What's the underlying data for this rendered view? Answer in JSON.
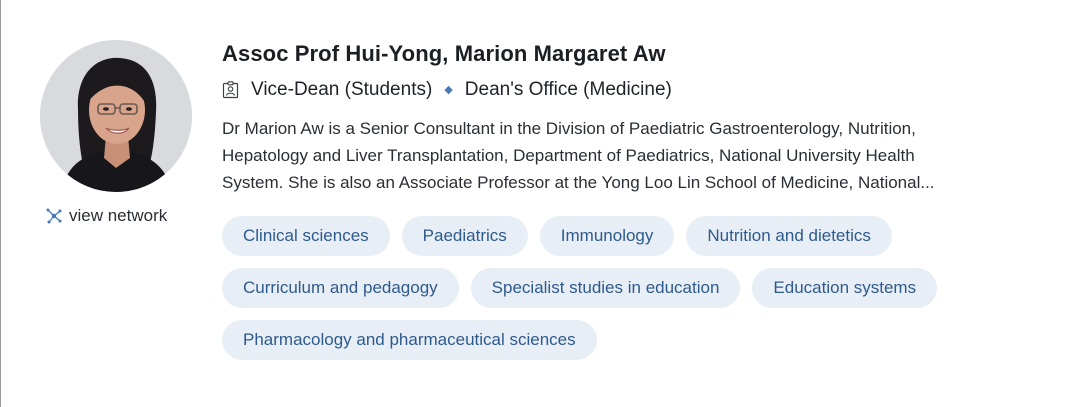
{
  "profile": {
    "name": "Assoc Prof Hui-Yong, Marion Margaret Aw",
    "role": "Vice-Dean (Students)",
    "department": "Dean's Office (Medicine)",
    "bio_lines": [
      "Dr Marion Aw is a Senior Consultant in the Division of Paediatric Gastroenterology, Nutrition,",
      "Hepatology and Liver Transplantation, Department of Paediatrics, National University Health",
      "System. She is also an Associate Professor at the Yong Loo Lin School of Medicine, National..."
    ],
    "view_network_label": "view network"
  },
  "tags": [
    "Clinical sciences",
    "Paediatrics",
    "Immunology",
    "Nutrition and dietetics",
    "Curriculum and pedagogy",
    "Specialist studies in education",
    "Education systems",
    "Pharmacology and pharmaceutical sciences"
  ],
  "icons": {
    "role": "id-badge-icon",
    "network": "network-icon",
    "separator": "diamond-separator-icon"
  },
  "colors": {
    "tag_background": "#e8eef5",
    "tag_text": "#2e5a8e",
    "accent": "#4a78b4"
  }
}
